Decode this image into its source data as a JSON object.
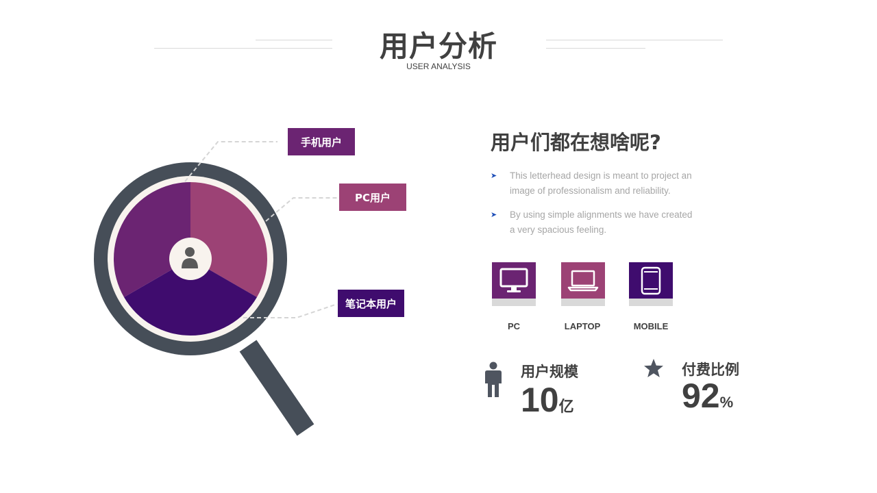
{
  "header": {
    "title": "用户分析",
    "subtitle": "USER ANALYSIS"
  },
  "diagram": {
    "segments": [
      {
        "label": "手机用户",
        "color": "#6b2472"
      },
      {
        "label": "PC用户",
        "color": "#9c4275"
      },
      {
        "label": "笔记本用户",
        "color": "#3f0c6e"
      }
    ],
    "ring_color": "#464e58",
    "inner_color": "#f8f3ee",
    "center_icon": "user-icon"
  },
  "content": {
    "question": "用户们都在想啥呢?",
    "bullets": [
      {
        "line1": "This letterhead design is meant to project an",
        "line2": "image of professionalism and reliability."
      },
      {
        "line1": "By using simple alignments we have created",
        "line2": "a very spacious feeling."
      }
    ],
    "bullet_icon": "arrow-bullet-icon"
  },
  "devices": [
    {
      "label": "PC",
      "icon": "monitor-icon",
      "color": "#6b2472"
    },
    {
      "label": "LAPTOP",
      "icon": "laptop-icon",
      "color": "#9c4275"
    },
    {
      "label": "MOBILE",
      "icon": "tablet-icon",
      "color": "#3f0c6e"
    }
  ],
  "stats": [
    {
      "label": "用户规模",
      "value": "10",
      "unit": "亿",
      "icon": "person-icon"
    },
    {
      "label": "付费比例",
      "value": "92",
      "unit": "%",
      "icon": "star-icon"
    }
  ]
}
